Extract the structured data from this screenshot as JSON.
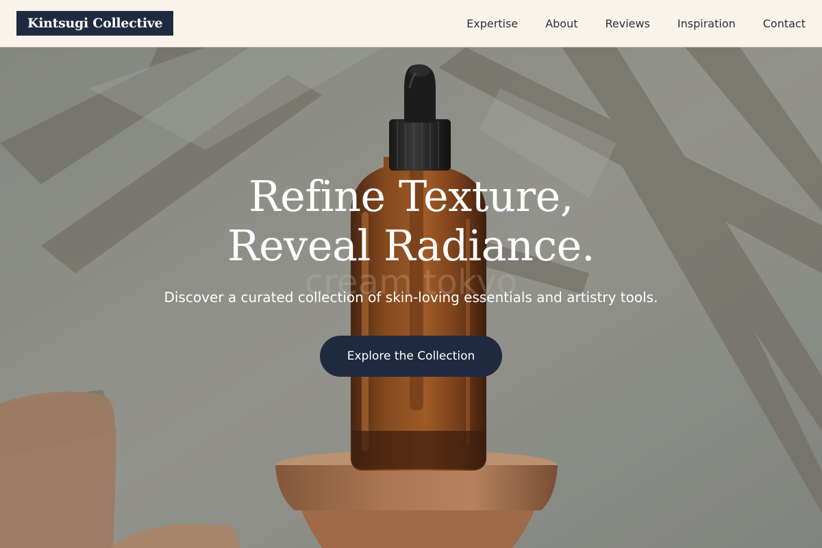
{
  "brand": {
    "name": "Kintsugi Collective",
    "bg_color": "#1f2a40"
  },
  "nav": {
    "items": [
      {
        "label": "Expertise"
      },
      {
        "label": "About"
      },
      {
        "label": "Reviews"
      },
      {
        "label": "Inspiration"
      },
      {
        "label": "Contact"
      }
    ]
  },
  "hero": {
    "headline_line1": "Refine Texture,",
    "headline_line2": "Reveal Radiance.",
    "subtitle": "Discover a curated collection of skin-loving essentials and artistry tools.",
    "cta_label": "Explore the Collection",
    "cta_color": "#1f2a40",
    "image_description_icon": "serum-dropper-bottle-image",
    "bottle_label_text": "cream tokyo"
  }
}
